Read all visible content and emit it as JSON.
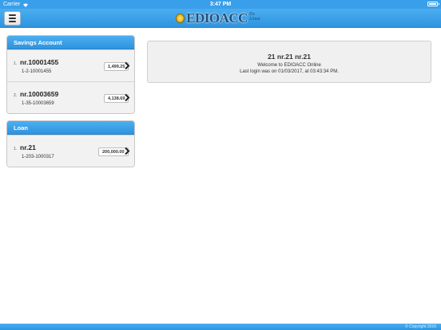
{
  "status_bar": {
    "carrier": "Carrier",
    "time": "3:47 PM"
  },
  "header": {
    "logo_text": "EDIOACC",
    "logo_tagline": "En Línea"
  },
  "savings": {
    "title": "Savings Account",
    "items": [
      {
        "index": "1.",
        "name": "nr.10001455",
        "number": "1-2-10001455",
        "amount": "1,499.25"
      },
      {
        "index": "2.",
        "name": "nr.10003659",
        "number": "1-35-10003659",
        "amount": "4,138.69"
      }
    ]
  },
  "loan": {
    "title": "Loan",
    "items": [
      {
        "index": "1.",
        "name": "nr.21",
        "number": "1-203-1000317",
        "amount": "200,000.00"
      }
    ]
  },
  "welcome": {
    "title": "21 nr.21 nr.21",
    "message": "Welcome to EDIOACC Online",
    "last_login": "Last login was on 01/03/2017, at 03:43:34 PM."
  },
  "footer": {
    "text": "© Copyright 2016"
  },
  "colors": {
    "header_blue": "#3a9fea",
    "panel_bg": "#efefef"
  }
}
